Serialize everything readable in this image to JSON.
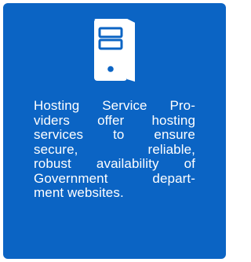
{
  "card": {
    "icon": "server-tower-icon",
    "background_color": "#0b64c4",
    "text_color": "#ffffff",
    "description_lines": [
      "Hosting Service Pro-",
      "viders offer hosting",
      "services to ensure",
      "secure,        reliable,",
      "robust availability of",
      "Government depart-",
      "ment websites."
    ]
  }
}
